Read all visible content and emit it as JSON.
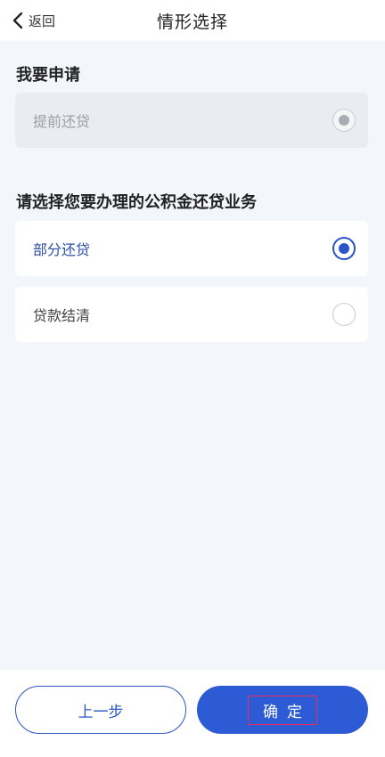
{
  "header": {
    "back_label": "返回",
    "title": "情形选择"
  },
  "apply": {
    "section_title": "我要申请",
    "option": {
      "label": "提前还贷",
      "state": "disabled-selected"
    }
  },
  "business": {
    "section_title": "请选择您要办理的公积金还贷业务",
    "options": [
      {
        "label": "部分还贷",
        "selected": true
      },
      {
        "label": "贷款结清",
        "selected": false
      }
    ]
  },
  "footer": {
    "prev_label": "上一步",
    "confirm_label": "确定"
  },
  "colors": {
    "accent": "#2b55c6",
    "page_bg": "#f3f6fb",
    "disabled_card": "#e9ecf1"
  }
}
